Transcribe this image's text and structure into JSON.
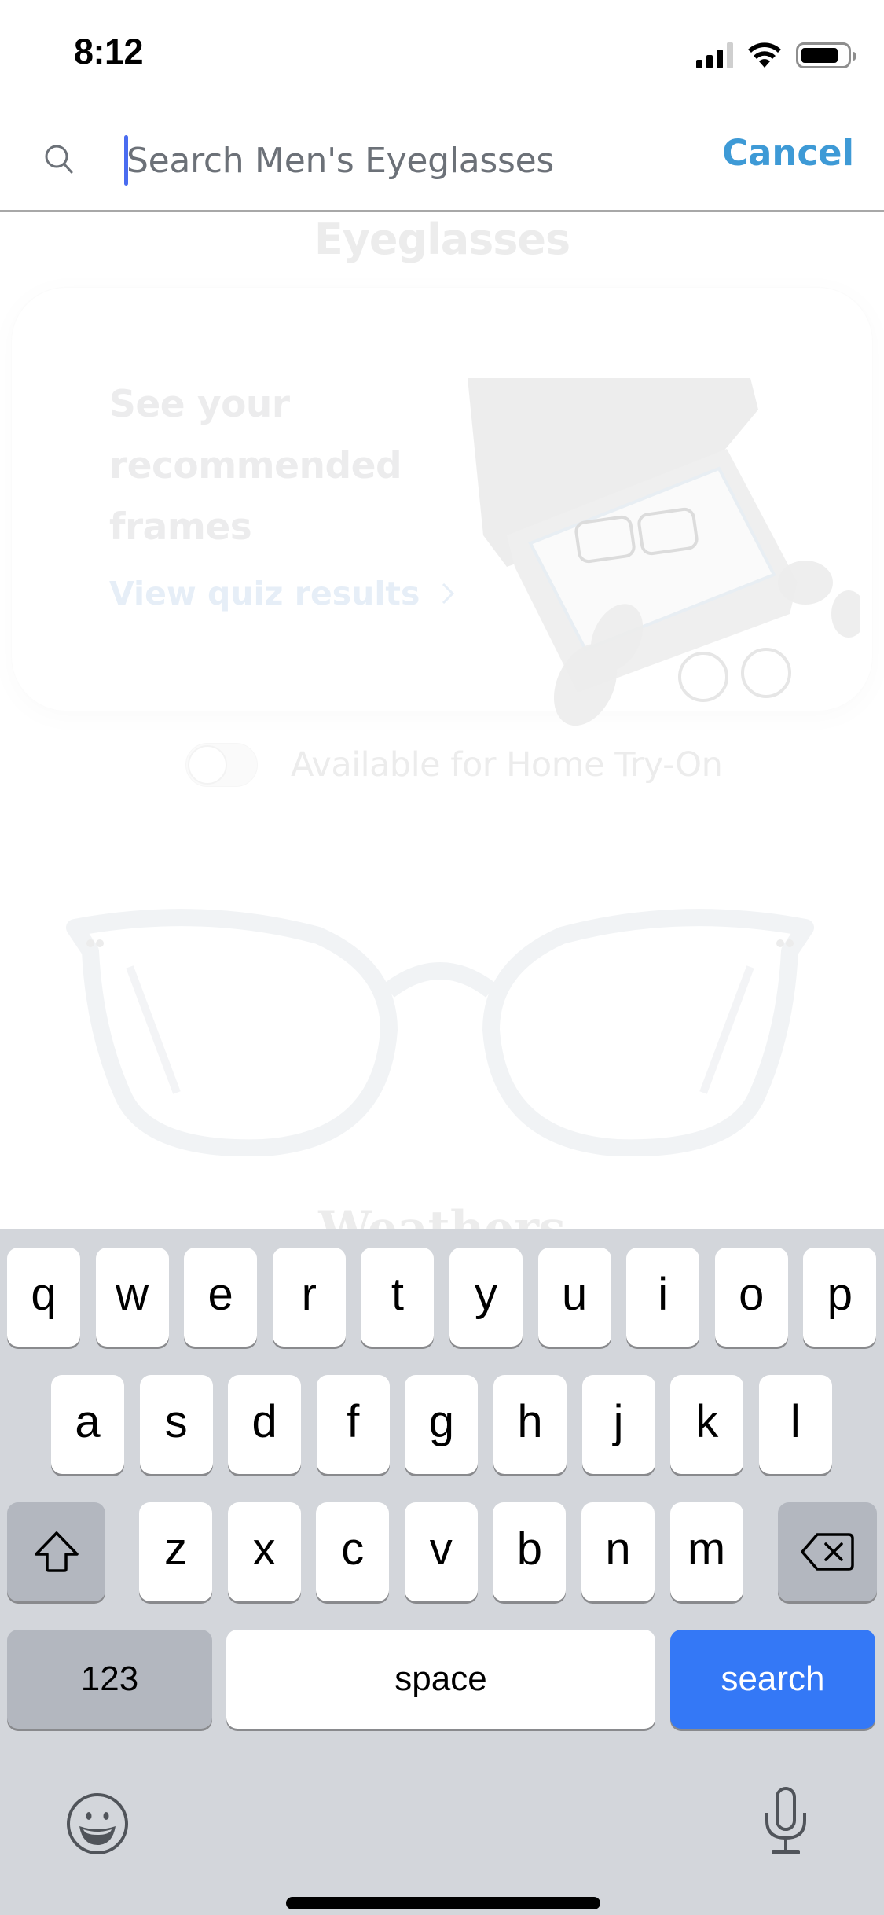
{
  "status_bar": {
    "time": "8:12",
    "signal_bars_active": 3,
    "signal_bars_total": 4,
    "wifi": "wifi-icon",
    "battery_level": 0.82
  },
  "search": {
    "placeholder": "Search Men's Eyeglasses",
    "value": "",
    "cancel_label": "Cancel",
    "icon": "search-icon",
    "colors": {
      "accent": "#3e9ad6",
      "cursor": "#4a6cf0",
      "placeholder": "#6c7178"
    }
  },
  "background_page": {
    "title": "Eyeglasses",
    "quiz_card": {
      "heading": "See your recommended frames",
      "link_label": "View quiz results",
      "image": "home-try-on-box-image"
    },
    "filter": {
      "label": "Available for Home Try-On",
      "toggle_on": false
    },
    "product": {
      "image": "clear-square-eyeglasses-image",
      "name": "Weathers"
    }
  },
  "keyboard": {
    "row1": [
      "q",
      "w",
      "e",
      "r",
      "t",
      "y",
      "u",
      "i",
      "o",
      "p"
    ],
    "row2": [
      "a",
      "s",
      "d",
      "f",
      "g",
      "h",
      "j",
      "k",
      "l"
    ],
    "row3": [
      "z",
      "x",
      "c",
      "v",
      "b",
      "n",
      "m"
    ],
    "shift_icon": "shift-icon",
    "delete_icon": "delete-icon",
    "numbers_label": "123",
    "space_label": "space",
    "action_label": "search",
    "emoji_icon": "emoji-icon",
    "mic_icon": "microphone-icon",
    "colors": {
      "background": "#d3d6db",
      "action": "#3478f6",
      "function_key": "#b3b7bf"
    }
  }
}
